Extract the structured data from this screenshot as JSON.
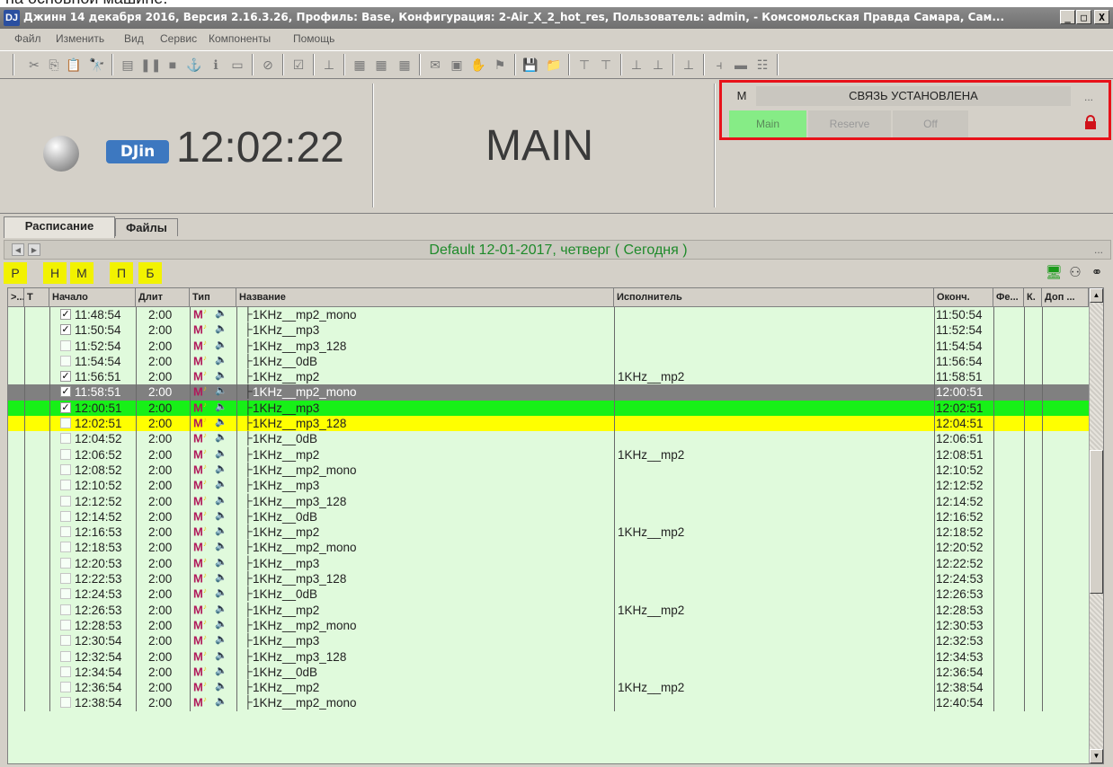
{
  "top_text": "на основной машине:",
  "window": {
    "title": "Джинн 14 декабря 2016, Версия 2.16.3.26, Профиль: Base, Конфигурация: 2-Air_X_2_hot_res, Пользователь: admin, - Комсомольская Правда Самара, Сам...",
    "min_label": "_",
    "max_label": "□",
    "close_label": "X",
    "app_icon_label": "DJ"
  },
  "menu": [
    "Файл",
    "Изменить",
    "Вид",
    "Сервис",
    "Компоненты",
    "Помощь"
  ],
  "status": {
    "clock": "12:02:22",
    "logo": "DJin",
    "mode": "MAIN",
    "connection": {
      "m_label": "М",
      "state": "СВЯЗЬ УСТАНОВЛЕНА",
      "more": "...",
      "channels": [
        "Main",
        "Reserve",
        "Off"
      ],
      "active_channel": "Main",
      "lock_color": "#d0121a"
    }
  },
  "tabs": [
    "Расписание",
    "Файлы"
  ],
  "schedule": {
    "title": "Default 12-01-2017, четверг ( Сегодня )",
    "more": "...",
    "filters": [
      "Р",
      "Н",
      "М",
      "П",
      "Б"
    ],
    "columns": [
      ">...",
      "Т",
      "Начало",
      "Длит",
      "Тип",
      "Название",
      "Исполнитель",
      "Оконч.",
      "Фе...",
      "К.",
      "Доп ..."
    ],
    "rows": [
      {
        "checked": true,
        "start": "11:48:54",
        "dur": "2:00",
        "name": "1KHz__mp2_mono",
        "artist": "",
        "end": "11:50:54",
        "state": ""
      },
      {
        "checked": true,
        "start": "11:50:54",
        "dur": "2:00",
        "name": "1KHz__mp3",
        "artist": "",
        "end": "11:52:54",
        "state": ""
      },
      {
        "checked": false,
        "start": "11:52:54",
        "dur": "2:00",
        "name": "1KHz__mp3_128",
        "artist": "",
        "end": "11:54:54",
        "state": ""
      },
      {
        "checked": false,
        "start": "11:54:54",
        "dur": "2:00",
        "name": "1KHz__0dB",
        "artist": "",
        "end": "11:56:54",
        "state": ""
      },
      {
        "checked": true,
        "start": "11:56:51",
        "dur": "2:00",
        "name": "1KHz__mp2",
        "artist": "1KHz__mp2",
        "end": "11:58:51",
        "state": ""
      },
      {
        "checked": true,
        "start": "11:58:51",
        "dur": "2:00",
        "name": "1KHz__mp2_mono",
        "artist": "",
        "end": "12:00:51",
        "state": "played"
      },
      {
        "checked": true,
        "start": "12:00:51",
        "dur": "2:00",
        "name": "1KHz__mp3",
        "artist": "",
        "end": "12:02:51",
        "state": "playing"
      },
      {
        "checked": false,
        "start": "12:02:51",
        "dur": "2:00",
        "name": "1KHz__mp3_128",
        "artist": "",
        "end": "12:04:51",
        "state": "next"
      },
      {
        "checked": false,
        "start": "12:04:52",
        "dur": "2:00",
        "name": "1KHz__0dB",
        "artist": "",
        "end": "12:06:51",
        "state": ""
      },
      {
        "checked": false,
        "start": "12:06:52",
        "dur": "2:00",
        "name": "1KHz__mp2",
        "artist": "1KHz__mp2",
        "end": "12:08:51",
        "state": ""
      },
      {
        "checked": false,
        "start": "12:08:52",
        "dur": "2:00",
        "name": "1KHz__mp2_mono",
        "artist": "",
        "end": "12:10:52",
        "state": ""
      },
      {
        "checked": false,
        "start": "12:10:52",
        "dur": "2:00",
        "name": "1KHz__mp3",
        "artist": "",
        "end": "12:12:52",
        "state": ""
      },
      {
        "checked": false,
        "start": "12:12:52",
        "dur": "2:00",
        "name": "1KHz__mp3_128",
        "artist": "",
        "end": "12:14:52",
        "state": ""
      },
      {
        "checked": false,
        "start": "12:14:52",
        "dur": "2:00",
        "name": "1KHz__0dB",
        "artist": "",
        "end": "12:16:52",
        "state": ""
      },
      {
        "checked": false,
        "start": "12:16:53",
        "dur": "2:00",
        "name": "1KHz__mp2",
        "artist": "1KHz__mp2",
        "end": "12:18:52",
        "state": ""
      },
      {
        "checked": false,
        "start": "12:18:53",
        "dur": "2:00",
        "name": "1KHz__mp2_mono",
        "artist": "",
        "end": "12:20:52",
        "state": ""
      },
      {
        "checked": false,
        "start": "12:20:53",
        "dur": "2:00",
        "name": "1KHz__mp3",
        "artist": "",
        "end": "12:22:52",
        "state": ""
      },
      {
        "checked": false,
        "start": "12:22:53",
        "dur": "2:00",
        "name": "1KHz__mp3_128",
        "artist": "",
        "end": "12:24:53",
        "state": ""
      },
      {
        "checked": false,
        "start": "12:24:53",
        "dur": "2:00",
        "name": "1KHz__0dB",
        "artist": "",
        "end": "12:26:53",
        "state": ""
      },
      {
        "checked": false,
        "start": "12:26:53",
        "dur": "2:00",
        "name": "1KHz__mp2",
        "artist": "1KHz__mp2",
        "end": "12:28:53",
        "state": ""
      },
      {
        "checked": false,
        "start": "12:28:53",
        "dur": "2:00",
        "name": "1KHz__mp2_mono",
        "artist": "",
        "end": "12:30:53",
        "state": ""
      },
      {
        "checked": false,
        "start": "12:30:54",
        "dur": "2:00",
        "name": "1KHz__mp3",
        "artist": "",
        "end": "12:32:53",
        "state": ""
      },
      {
        "checked": false,
        "start": "12:32:54",
        "dur": "2:00",
        "name": "1KHz__mp3_128",
        "artist": "",
        "end": "12:34:53",
        "state": ""
      },
      {
        "checked": false,
        "start": "12:34:54",
        "dur": "2:00",
        "name": "1KHz__0dB",
        "artist": "",
        "end": "12:36:54",
        "state": ""
      },
      {
        "checked": false,
        "start": "12:36:54",
        "dur": "2:00",
        "name": "1KHz__mp2",
        "artist": "1KHz__mp2",
        "end": "12:38:54",
        "state": ""
      },
      {
        "checked": false,
        "start": "12:38:54",
        "dur": "2:00",
        "name": "1KHz__mp2_mono",
        "artist": "",
        "end": "12:40:54",
        "state": ""
      }
    ]
  },
  "colors": {
    "played": "#808080",
    "playing": "#17f017",
    "next": "#ffff00",
    "grid_bg": "#e0fadc",
    "title_green": "#1e8a2a",
    "highlight_box": "#e8121a"
  },
  "icons": {
    "toolbar": [
      "cut-icon",
      "copy-icon",
      "paste-icon",
      "find-icon",
      "page-icon",
      "pause-icon",
      "stop-icon",
      "anchor-icon",
      "info-icon",
      "comment-icon",
      "forbidden-icon",
      "checkbox-icon",
      "step-icon",
      "block1-icon",
      "block2-icon",
      "block3-icon",
      "mail-icon",
      "image-icon",
      "hand-icon",
      "flag-icon",
      "disk-icon",
      "folder-icon",
      "up1-icon",
      "up2-icon",
      "down1-icon",
      "down2-icon",
      "insert-icon",
      "marker-icon",
      "minus-icon",
      "list-icon"
    ],
    "row_type": "music-type-icon",
    "row_sound": "speaker-icon"
  }
}
